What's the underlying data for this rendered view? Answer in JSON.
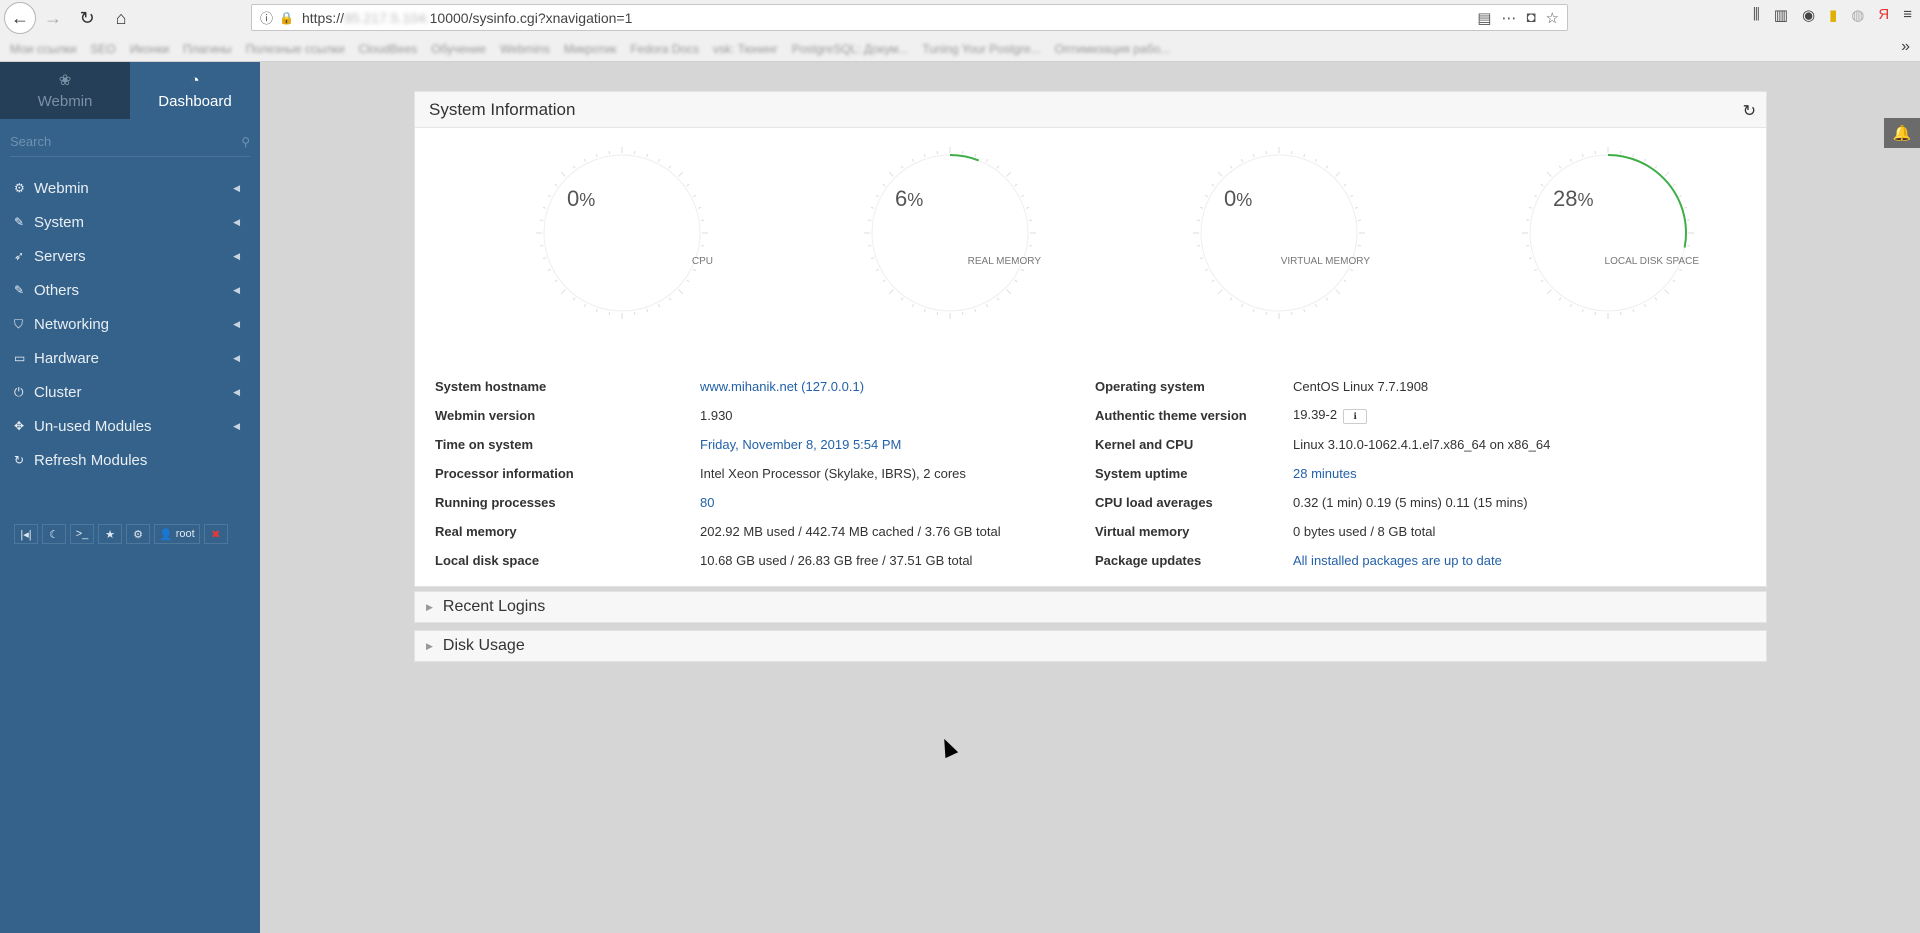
{
  "browser": {
    "url_prefix": "https://",
    "url_host": "95.217.5.104:",
    "url_path": "10000/sysinfo.cgi?xnavigation=1",
    "bookmarks": [
      "Мои ссылки",
      "SEO",
      "Иконки",
      "Плагины",
      "Полезные ссылки",
      "CloudBees",
      "Обучение",
      "Webmins",
      "Микротик",
      "Fedora Docs",
      "vsk: Тюнинг",
      "PostgreSQL: Докум...",
      "Tuning Your Postgre...",
      "Оптимизация рабо..."
    ]
  },
  "sidebar": {
    "tabs": [
      {
        "label": "Webmin",
        "icon": "webmin-logo-icon"
      },
      {
        "label": "Dashboard",
        "icon": "dashboard-gauge-icon"
      }
    ],
    "search_placeholder": "Search",
    "items": [
      {
        "label": "Webmin",
        "icon": "gear-icon"
      },
      {
        "label": "System",
        "icon": "wrench-icon"
      },
      {
        "label": "Servers",
        "icon": "rocket-icon"
      },
      {
        "label": "Others",
        "icon": "wrench-icon"
      },
      {
        "label": "Networking",
        "icon": "shield-icon"
      },
      {
        "label": "Hardware",
        "icon": "hdd-icon"
      },
      {
        "label": "Cluster",
        "icon": "power-icon"
      },
      {
        "label": "Un-used Modules",
        "icon": "puzzle-icon"
      },
      {
        "label": "Refresh Modules",
        "icon": "refresh-icon"
      }
    ],
    "bottom_user": "root"
  },
  "panel": {
    "title": "System Information"
  },
  "gauges": [
    {
      "label": "CPU",
      "value": 0,
      "unit": "%"
    },
    {
      "label": "REAL MEMORY",
      "value": 6,
      "unit": "%"
    },
    {
      "label": "VIRTUAL MEMORY",
      "value": 0,
      "unit": "%"
    },
    {
      "label": "LOCAL DISK SPACE",
      "value": 28,
      "unit": "%"
    }
  ],
  "info": {
    "left": [
      {
        "key": "System hostname",
        "value": "www.mihanik.net (127.0.0.1)",
        "link": true
      },
      {
        "key": "Webmin version",
        "value": "1.930",
        "link": false
      },
      {
        "key": "Time on system",
        "value": "Friday, November 8, 2019 5:54 PM",
        "link": true
      },
      {
        "key": "Processor information",
        "value": "Intel Xeon Processor (Skylake, IBRS), 2 cores",
        "link": false
      },
      {
        "key": "Running processes",
        "value": "80",
        "link": true
      },
      {
        "key": "Real memory",
        "value": "202.92 MB used / 442.74 MB cached / 3.76 GB total",
        "link": false
      },
      {
        "key": "Local disk space",
        "value": "10.68 GB used / 26.83 GB free / 37.51 GB total",
        "link": false
      }
    ],
    "right": [
      {
        "key": "Operating system",
        "value": "CentOS Linux 7.7.1908",
        "link": false
      },
      {
        "key": "Authentic theme version",
        "value": "19.39-2",
        "link": false
      },
      {
        "key": "Kernel and CPU",
        "value": "Linux 3.10.0-1062.4.1.el7.x86_64 on x86_64",
        "link": false
      },
      {
        "key": "System uptime",
        "value": "28 minutes",
        "link": true
      },
      {
        "key": "CPU load averages",
        "value": "0.32 (1 min) 0.19 (5 mins) 0.11 (15 mins)",
        "link": false
      },
      {
        "key": "Virtual memory",
        "value": "0 bytes used / 8 GB total",
        "link": false
      },
      {
        "key": "Package updates",
        "value": "All installed packages are up to date",
        "link": true
      }
    ]
  },
  "sections": [
    "Recent Logins",
    "Disk Usage"
  ],
  "colors": {
    "sidebar_bg": "#35628a",
    "sidebar_dark": "#253f58",
    "gauge_fill": "#3fae49",
    "link": "#2361a8"
  }
}
